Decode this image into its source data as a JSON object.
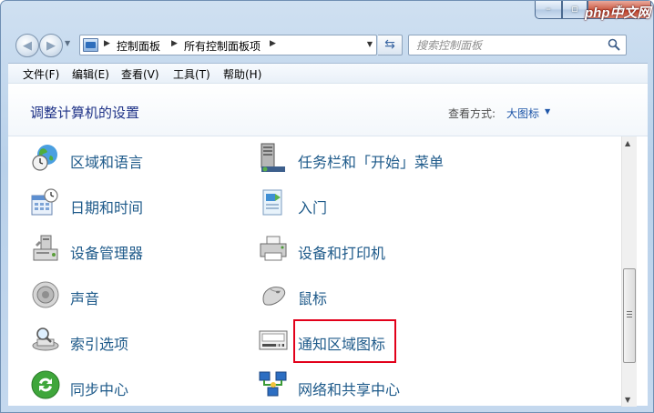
{
  "window": {
    "watermark": "php中文网",
    "controls": {
      "minimize": "–",
      "maximize": "▫",
      "close": "✕"
    }
  },
  "nav": {
    "breadcrumbs": [
      "控制面板",
      "所有控制面板项"
    ],
    "search_placeholder": "搜索控制面板"
  },
  "menubar": [
    "文件(F)",
    "编辑(E)",
    "查看(V)",
    "工具(T)",
    "帮助(H)"
  ],
  "content": {
    "heading": "调整计算机的设置",
    "view_by_label": "查看方式:",
    "view_by_value": "大图标"
  },
  "items": {
    "left": [
      {
        "label": "区域和语言",
        "icon": "region-language-icon"
      },
      {
        "label": "日期和时间",
        "icon": "date-time-icon"
      },
      {
        "label": "设备管理器",
        "icon": "device-manager-icon"
      },
      {
        "label": "声音",
        "icon": "sound-icon"
      },
      {
        "label": "索引选项",
        "icon": "indexing-options-icon"
      },
      {
        "label": "同步中心",
        "icon": "sync-center-icon"
      }
    ],
    "right": [
      {
        "label": "任务栏和「开始」菜单",
        "icon": "taskbar-start-menu-icon"
      },
      {
        "label": "入门",
        "icon": "getting-started-icon"
      },
      {
        "label": "设备和打印机",
        "icon": "devices-printers-icon"
      },
      {
        "label": "鼠标",
        "icon": "mouse-icon"
      },
      {
        "label": "通知区域图标",
        "icon": "notification-area-icon",
        "highlighted": true
      },
      {
        "label": "网络和共享中心",
        "icon": "network-sharing-icon"
      }
    ]
  },
  "colors": {
    "link": "#1e5a8a",
    "heading": "#1e3287",
    "highlight_box": "#e2001a"
  }
}
